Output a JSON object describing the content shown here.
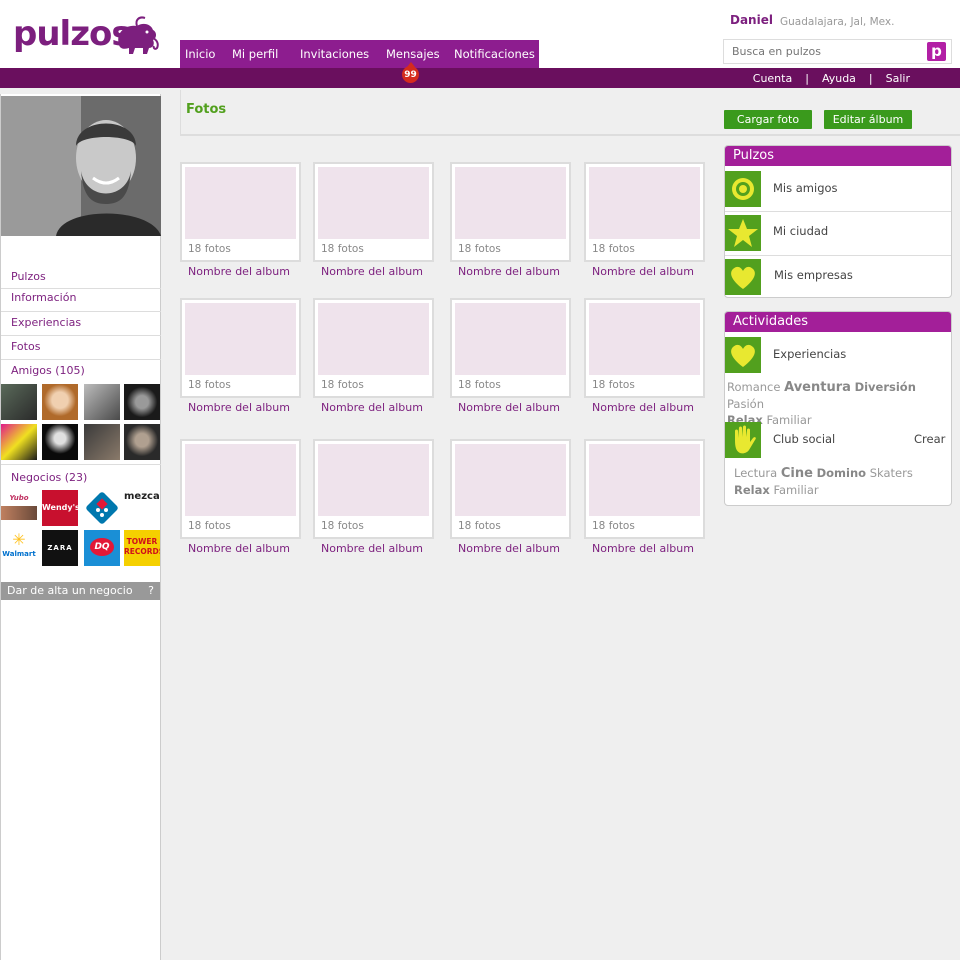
{
  "header": {
    "logo_text": "pulzos",
    "user_name": "Daniel",
    "user_location": "Guadalajara, Jal, Mex.",
    "search_placeholder": "Busca en pulzos",
    "search_button": "p",
    "nav": [
      "Inicio",
      "Mi perfil",
      "Invitaciones",
      "Mensajes",
      "Notificaciones"
    ],
    "messages_badge": "99",
    "top_links": [
      "Cuenta",
      "Ayuda",
      "Salir"
    ],
    "top_sep": "|"
  },
  "sidebar": {
    "links": [
      "Pulzos",
      "Información",
      "Experiencias",
      "Fotos"
    ],
    "friends_label": "Amigos (105)",
    "business_label": "Negocios (23)",
    "businesses": [
      "Yubo",
      "Wendy's",
      "Domino's",
      "mezcal",
      "Walmart",
      "ZARA",
      "DQ",
      "TOWER RECORDS"
    ],
    "alta_label": "Dar de alta un negocio",
    "alta_help": "?"
  },
  "main": {
    "title": "Fotos",
    "btn_upload": "Cargar foto",
    "btn_edit": "Editar álbum",
    "albums": [
      {
        "count": "18 fotos",
        "name": "Nombre del album"
      },
      {
        "count": "18 fotos",
        "name": "Nombre del album"
      },
      {
        "count": "18 fotos",
        "name": "Nombre del album"
      },
      {
        "count": "18 fotos",
        "name": "Nombre del album"
      },
      {
        "count": "18 fotos",
        "name": "Nombre del album"
      },
      {
        "count": "18 fotos",
        "name": "Nombre del album"
      },
      {
        "count": "18 fotos",
        "name": "Nombre del album"
      },
      {
        "count": "18 fotos",
        "name": "Nombre del album"
      },
      {
        "count": "18 fotos",
        "name": "Nombre del album"
      },
      {
        "count": "18 fotos",
        "name": "Nombre del album"
      },
      {
        "count": "18 fotos",
        "name": "Nombre del album"
      },
      {
        "count": "18 fotos",
        "name": "Nombre del album"
      }
    ]
  },
  "widgets": {
    "pulzos": {
      "title": "Pulzos",
      "items": [
        "Mis amigos",
        "Mi ciudad",
        "Mis empresas"
      ]
    },
    "actividades": {
      "title": "Actividades",
      "experiencias": "Experiencias",
      "exp_tags": {
        "t1": "Romance",
        "t2": "Aventura",
        "t3": "Diversión",
        "t4": "Pasión",
        "t5": "Relax",
        "t6": "Familiar"
      },
      "club": "Club social",
      "crear": "Crear",
      "club_tags": {
        "t1": "Lectura",
        "t2": "Cine",
        "t3": "Domino",
        "t4": "Skaters",
        "t5": "Relax",
        "t6": "Familiar"
      }
    }
  },
  "colors": {
    "brand_purple": "#7c1f7e",
    "nav_purple": "#8d1d8f",
    "bar_purple": "#6a0f5e",
    "accent_green": "#52a01e"
  }
}
